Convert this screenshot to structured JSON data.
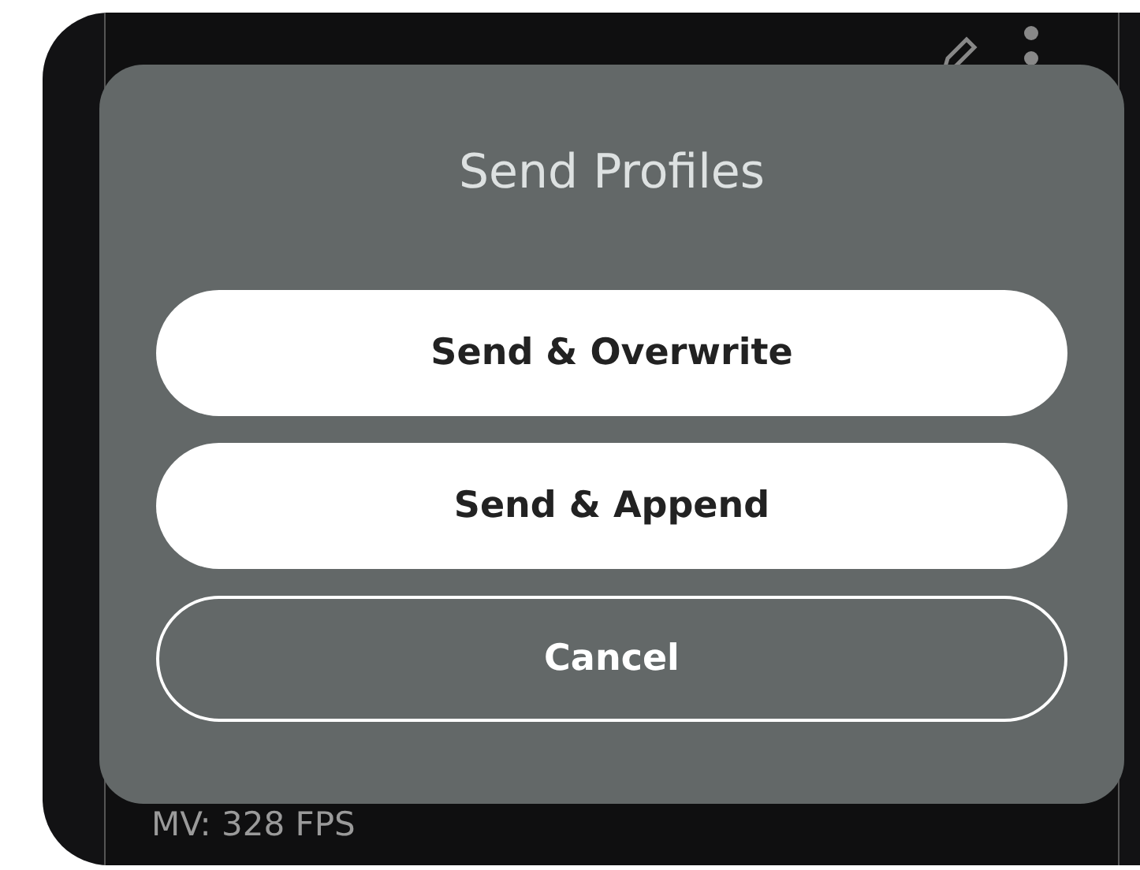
{
  "background_screen": {
    "status": "MV: 328 FPS"
  },
  "dialog": {
    "title": "Send Profiles",
    "buttons": [
      {
        "label": "Send & Overwrite",
        "kind": "filled"
      },
      {
        "label": "Send & Append",
        "kind": "filled"
      },
      {
        "label": "Cancel",
        "kind": "outlined"
      }
    ]
  }
}
